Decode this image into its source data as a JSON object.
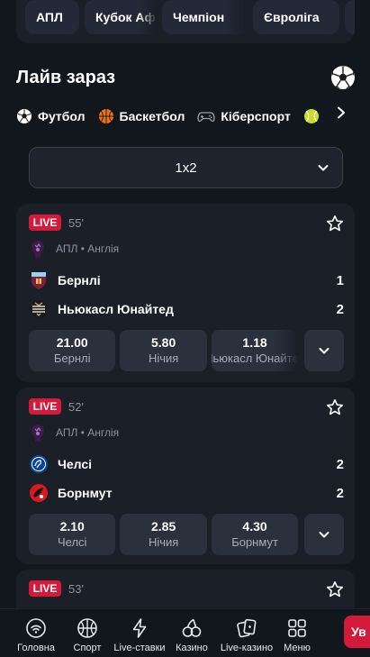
{
  "competitions": [
    "АПЛ",
    "Кубок Аф",
    "Чемпіон",
    "Євроліга",
    "І"
  ],
  "live": {
    "title": "Лайв зараз"
  },
  "sports": [
    {
      "label": "Футбол",
      "icon": "football-icon",
      "active": true
    },
    {
      "label": "Баскетбол",
      "icon": "basketball-icon",
      "active": false
    },
    {
      "label": "Кіберспорт",
      "icon": "gamepad-icon",
      "active": false
    },
    {
      "label": "",
      "icon": "tennis-icon",
      "active": false
    }
  ],
  "market": {
    "selected": "1x2"
  },
  "events": [
    {
      "badge": "LIVE",
      "minute": "55'",
      "league": "АПЛ • Англія",
      "home": {
        "name": "Бернлі",
        "score": "1",
        "icon": "burnley-logo"
      },
      "away": {
        "name": "Ньюкасл Юнайтед",
        "score": "2",
        "icon": "newcastle-logo"
      },
      "odds": [
        {
          "value": "21.00",
          "label": "Бернлі"
        },
        {
          "value": "5.80",
          "label": "Нічия"
        },
        {
          "value": "1.18",
          "label": "Ньюкасл Юнайтед"
        }
      ]
    },
    {
      "badge": "LIVE",
      "minute": "52'",
      "league": "АПЛ • Англія",
      "home": {
        "name": "Челсі",
        "score": "2",
        "icon": "chelsea-logo"
      },
      "away": {
        "name": "Борнмут",
        "score": "2",
        "icon": "bournemouth-logo"
      },
      "odds": [
        {
          "value": "2.10",
          "label": "Челсі"
        },
        {
          "value": "2.85",
          "label": "Нічия"
        },
        {
          "value": "4.30",
          "label": "Борнмут"
        }
      ]
    },
    {
      "badge": "LIVE",
      "minute": "53'"
    }
  ],
  "nav": [
    {
      "label": "Головна",
      "icon": "home-icon"
    },
    {
      "label": "Спорт",
      "icon": "basketball-icon"
    },
    {
      "label": "Live-ставки",
      "icon": "lightning-icon"
    },
    {
      "label": "Казино",
      "icon": "cherries-icon"
    },
    {
      "label": "Live-казино",
      "icon": "cards-icon"
    },
    {
      "label": "Меню",
      "icon": "grid-icon"
    }
  ],
  "login": {
    "label": "Ув"
  },
  "colors": {
    "accent": "#d31a3a",
    "background": "#12161d",
    "card": "#1a1f28",
    "button": "#2a303c"
  }
}
